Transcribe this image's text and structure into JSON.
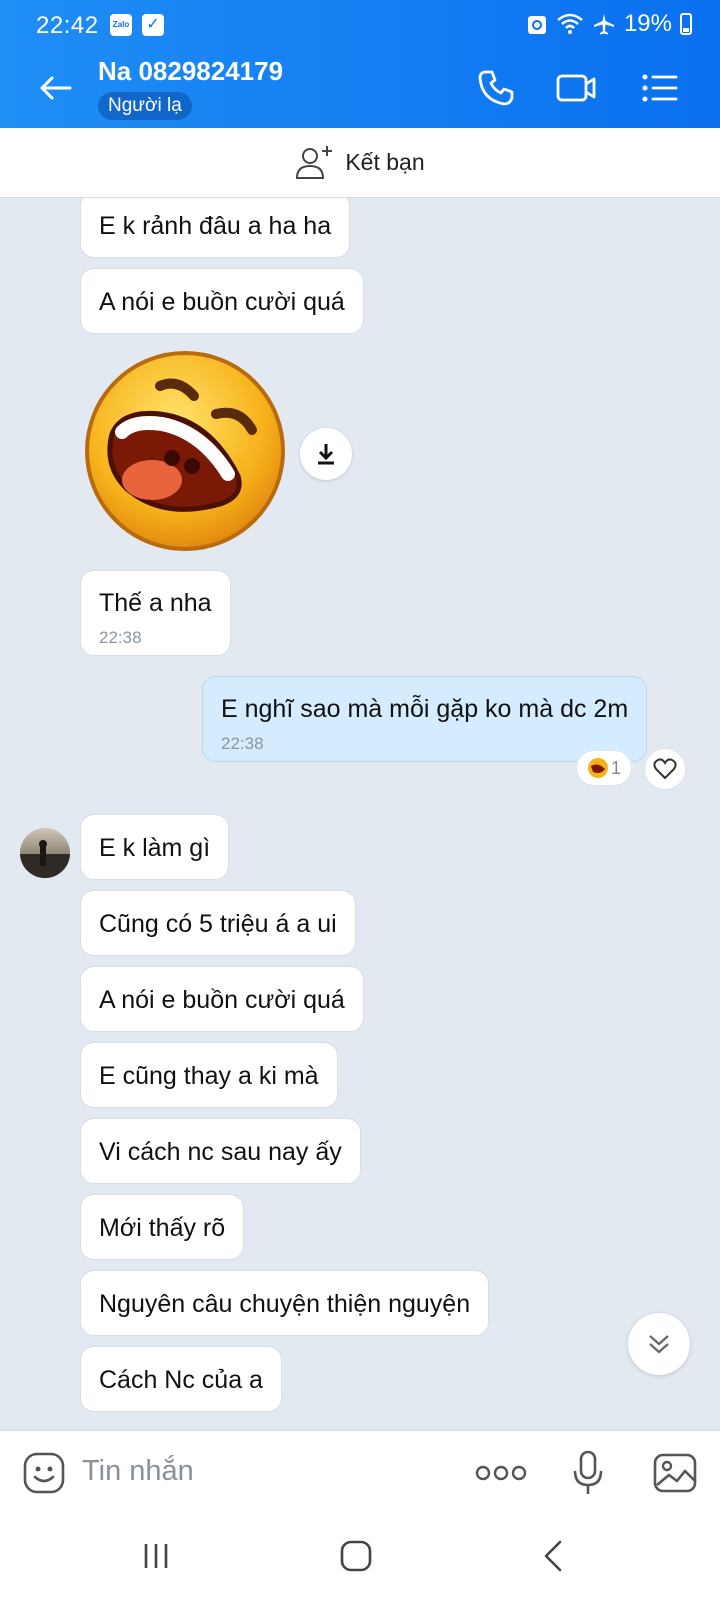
{
  "status_bar": {
    "time": "22:42",
    "battery": "19%",
    "app_badge": "Zalo"
  },
  "header": {
    "contact_name": "Na 0829824179",
    "badge": "Người lạ"
  },
  "friend_bar": {
    "label": "Kết bạn"
  },
  "messages": [
    {
      "side": "left",
      "text": "E k rảnh đâu a ha ha"
    },
    {
      "side": "left",
      "text": "A nói e buồn cười quá"
    },
    {
      "side": "left",
      "type": "sticker",
      "icon": "laughing-face-sticker"
    },
    {
      "side": "left",
      "text": "Thế a nha",
      "time": "22:38"
    },
    {
      "side": "right",
      "text": "E nghĩ sao mà mỗi gặp ko mà dc 2m",
      "time": "22:38",
      "reaction_count": "1"
    },
    {
      "side": "left",
      "text": "E k làm gì"
    },
    {
      "side": "left",
      "text": "Cũng có 5 triệu á a ui"
    },
    {
      "side": "left",
      "text": "A nói e buồn cười quá"
    },
    {
      "side": "left",
      "text": "E cũng thay a ki mà"
    },
    {
      "side": "left",
      "text": "Vi cách nc sau nay ấy"
    },
    {
      "side": "left",
      "text": "Mới thấy rõ"
    },
    {
      "side": "left",
      "text": "Nguyên câu chuyện thiện nguyện"
    },
    {
      "side": "left",
      "text": "Cách Nc của a"
    }
  ],
  "composer": {
    "placeholder": "Tin nhắn"
  },
  "colors": {
    "header": "#0a70f0",
    "bubble_me": "#d5ecff",
    "bubble_other": "#ffffff",
    "chat_bg": "#e2e9f1"
  }
}
